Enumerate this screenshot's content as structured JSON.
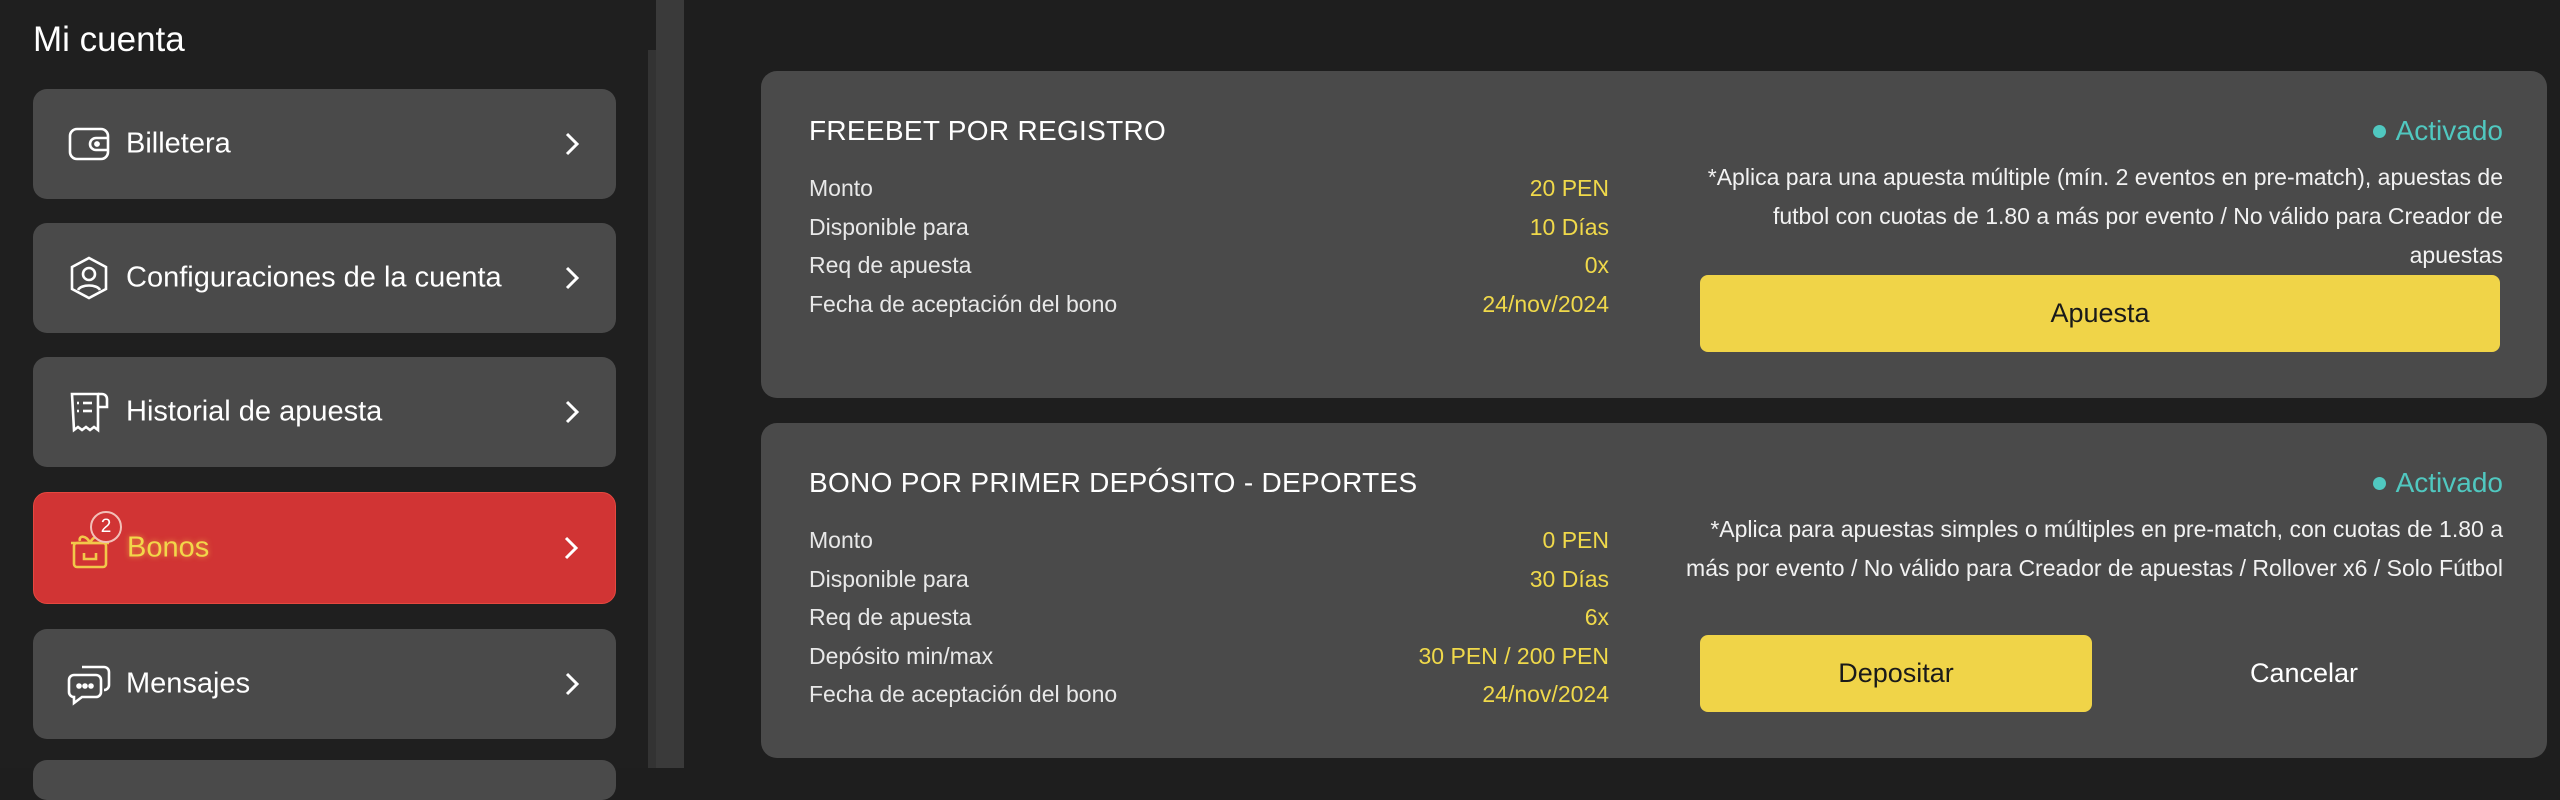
{
  "sidebar": {
    "title": "Mi cuenta",
    "items": [
      {
        "label": "Billetera",
        "icon": "wallet-icon"
      },
      {
        "label": "Configuraciones de la cuenta",
        "icon": "user-shield-icon"
      },
      {
        "label": "Historial de apuesta",
        "icon": "receipt-icon"
      },
      {
        "label": "Bonos",
        "icon": "gift-icon",
        "badge": "2",
        "active": true
      },
      {
        "label": "Mensajes",
        "icon": "chat-icon"
      }
    ]
  },
  "bonuses": [
    {
      "title": "FREEBET POR REGISTRO",
      "status": "Activado",
      "rows": [
        {
          "label": "Monto",
          "value": "20 PEN"
        },
        {
          "label": "Disponible para",
          "value": "10 Días"
        },
        {
          "label": "Req de apuesta",
          "value": "0x"
        },
        {
          "label": "Fecha de aceptación del bono",
          "value": "24/nov/2024"
        }
      ],
      "terms": "*Aplica para una apuesta múltiple (mín. 2 eventos en pre-match), apuestas de futbol con cuotas de 1.80 a más por evento / No válido para Creador de apuestas",
      "primary_button": "Apuesta"
    },
    {
      "title": "BONO POR PRIMER DEPÓSITO - DEPORTES",
      "status": "Activado",
      "rows": [
        {
          "label": "Monto",
          "value": "0 PEN"
        },
        {
          "label": "Disponible para",
          "value": "30 Días"
        },
        {
          "label": "Req de apuesta",
          "value": "6x"
        },
        {
          "label": "Depósito min/max",
          "value": "30 PEN / 200 PEN"
        },
        {
          "label": "Fecha de aceptación del bono",
          "value": "24/nov/2024"
        }
      ],
      "terms": "*Aplica para apuestas simples o múltiples en pre-match, con cuotas de 1.80 a más por evento / No válido para Creador de apuestas / Rollover x6 / Solo Fútbol",
      "primary_button": "Depositar",
      "secondary_button": "Cancelar"
    }
  ],
  "colors": {
    "active_item": "#d13434",
    "accent_yellow": "#f0d448",
    "status_teal": "#50c8c0",
    "card_bg": "#4a4a4a"
  }
}
